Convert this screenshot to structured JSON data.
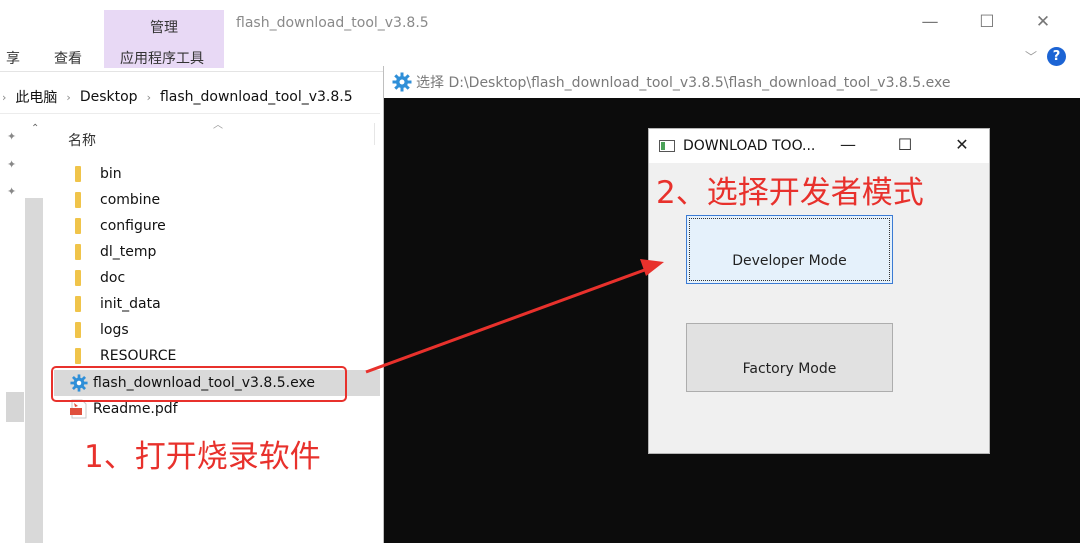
{
  "explorer": {
    "title": "flash_download_tool_v3.8.5",
    "ribbon": {
      "context_group": "管理",
      "tabs": [
        "享",
        "查看",
        "应用程序工具"
      ]
    },
    "window_controls": {
      "minimize": "—",
      "maximize": "☐",
      "close": "✕"
    },
    "help": "?",
    "breadcrumb": [
      "此电脑",
      "Desktop",
      "flash_download_tool_v3.8.5"
    ],
    "column_header": "名称",
    "files": [
      {
        "name": "bin",
        "type": "folder"
      },
      {
        "name": "combine",
        "type": "folder"
      },
      {
        "name": "configure",
        "type": "folder"
      },
      {
        "name": "dl_temp",
        "type": "folder"
      },
      {
        "name": "doc",
        "type": "folder"
      },
      {
        "name": "init_data",
        "type": "folder"
      },
      {
        "name": "logs",
        "type": "folder"
      },
      {
        "name": "RESOURCE",
        "type": "folder"
      },
      {
        "name": "flash_download_tool_v3.8.5.exe",
        "type": "exe",
        "selected": true
      },
      {
        "name": "Readme.pdf",
        "type": "pdf"
      }
    ]
  },
  "console": {
    "title": "选择 D:\\Desktop\\flash_download_tool_v3.8.5\\flash_download_tool_v3.8.5.exe"
  },
  "dialog": {
    "title": "DOWNLOAD TOO...",
    "controls": {
      "minimize": "—",
      "maximize": "☐",
      "close": "✕"
    },
    "buttons": {
      "developer": "Developer Mode",
      "factory": "Factory Mode"
    }
  },
  "annotations": {
    "step1": "1、打开烧录软件",
    "step2": "2、选择开发者模式",
    "color": "#e8312c"
  }
}
